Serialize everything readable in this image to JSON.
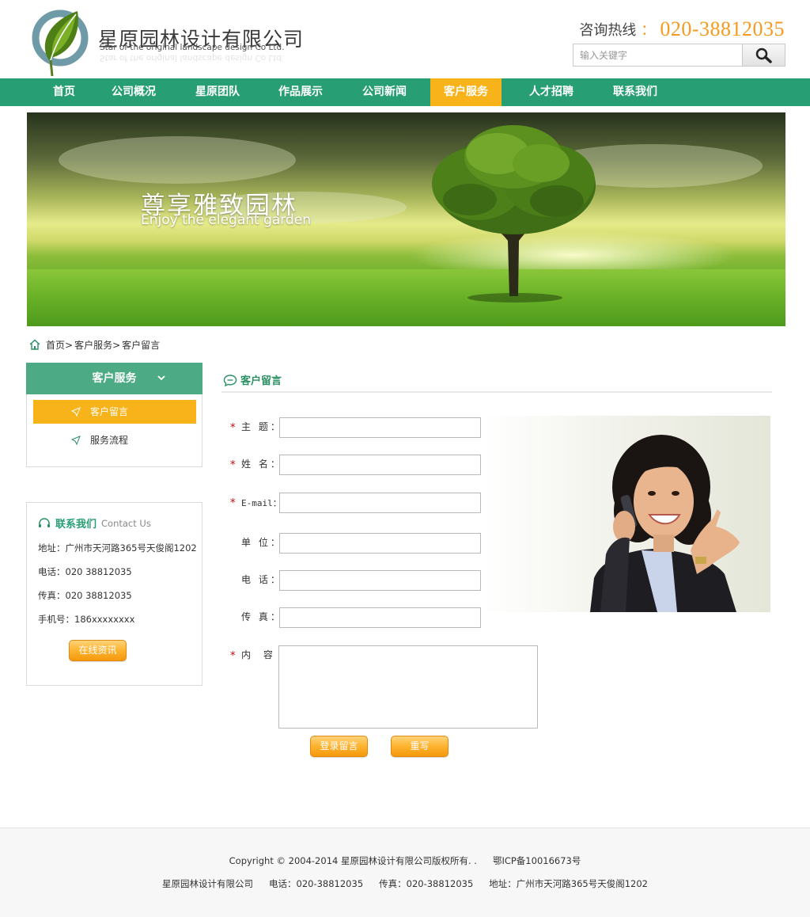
{
  "header": {
    "company_name": "星原园林设计有限公司",
    "company_name_en": "Star of the original landscape design Co Ltd.",
    "hotline_label": "咨询热线",
    "hotline_colon": "：",
    "hotline_number": "020-38812035",
    "search_placeholder": "输入关键字"
  },
  "nav": {
    "items": [
      "首页",
      "公司概况",
      "星原团队",
      "作品展示",
      "公司新闻",
      "客户服务",
      "人才招聘",
      "联系我们"
    ],
    "active": "客户服务"
  },
  "banner": {
    "title": "尊享雅致园林",
    "subtitle": "Enjoy the elegant garden"
  },
  "breadcrumb": [
    "首页>",
    "客户服务>",
    "客户留言"
  ],
  "sidebar": {
    "title": "客户服务",
    "items": [
      "客户留言",
      "服务流程"
    ]
  },
  "contact": {
    "title": "联系我们",
    "title_en": "Contact Us",
    "address": "地址：广州市天河路365号天俊阁1202",
    "phone": "电话：020  38812035",
    "fax": "传真：020  38812035",
    "mobile": "手机号：186xxxxxxxx",
    "button": "在线资讯"
  },
  "form": {
    "section_title": "客户留言",
    "required_mark": "*",
    "fields": {
      "subject": "主 题：",
      "name": "姓 名：",
      "email": "E-mail：",
      "company": "单 位：",
      "phone": "电 话：",
      "fax": "传 真：",
      "content": "内 容"
    },
    "submit": "登录留言",
    "reset": "重写"
  },
  "footer": {
    "copyright": "Copyright © 2004-2014  星原园林设计有限公司版权所有. .",
    "icp": "鄂ICP备10016673号",
    "company": "星原园林设计有限公司",
    "phone": "电话：020-38812035",
    "fax": "传真：020-38812035",
    "address": "地址：广州市天河路365号天俊阁1202"
  },
  "colors": {
    "brand_green": "#279e74",
    "accent_orange": "#f9b31a",
    "hotline_orange": "#f59b20"
  }
}
